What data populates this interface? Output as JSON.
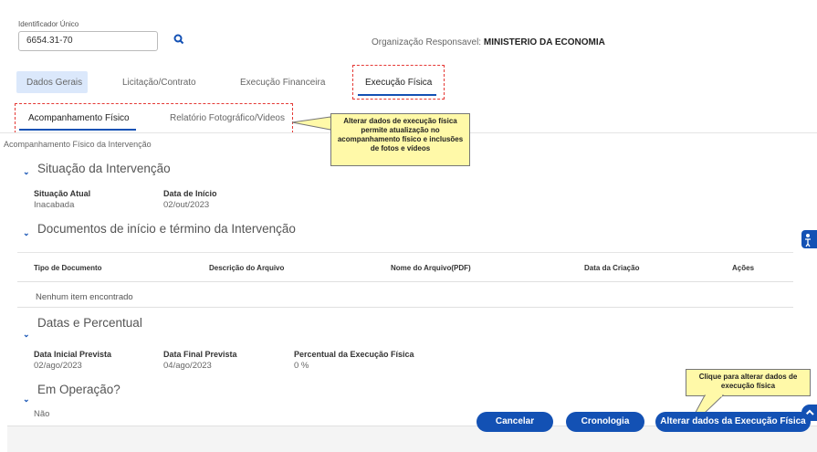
{
  "form": {
    "identificador_label": "Identificador Único",
    "identificador_value": "6654.31-70",
    "org_label": "Organização Responsavel: ",
    "org_value": "MINISTERIO DA ECONOMIA"
  },
  "tabs": [
    {
      "label": "Dados Gerais"
    },
    {
      "label": "Licitação/Contrato"
    },
    {
      "label": "Execução Financeira"
    },
    {
      "label": "Execução Física"
    }
  ],
  "subtabs": [
    {
      "label": "Acompanhamento Físico"
    },
    {
      "label": "Relatório Fotográfico/Videos"
    }
  ],
  "callout_top": "Alterar dados de execução física permite atualização no acompanhamento físico e inclusões de fotos e vídeos",
  "callout_bottom": "Clique para alterar dados de execução física",
  "breadcrumb": "Acompanhamento Físico da Intervenção",
  "situacao": {
    "title": "Situação da Intervenção",
    "atual_label": "Situação Atual",
    "atual_value": "Inacabada",
    "inicio_label": "Data de Início",
    "inicio_value": "02/out/2023"
  },
  "documentos": {
    "title": "Documentos de início e término da Intervenção",
    "columns": [
      "Tipo de Documento",
      "Descrição do Arquivo",
      "Nome do Arquivo(PDF)",
      "Data da Criação",
      "Ações"
    ],
    "empty": "Nenhum item encontrado"
  },
  "datas": {
    "title": "Datas e Percentual",
    "inicial_label": "Data Inicial Prevista",
    "inicial_value": "02/ago/2023",
    "final_label": "Data Final Prevista",
    "final_value": "04/ago/2023",
    "percentual_label": "Percentual da Execução Física",
    "percentual_value": "0 %"
  },
  "operacao": {
    "title": "Em Operação?",
    "value": "Não"
  },
  "footer": {
    "cancelar": "Cancelar",
    "cronologia": "Cronologia",
    "alterar": "Alterar dados da Execução Física"
  },
  "colors": {
    "primary": "#1351b4",
    "callout": "#fff9a8",
    "highlight": "#e53935"
  }
}
